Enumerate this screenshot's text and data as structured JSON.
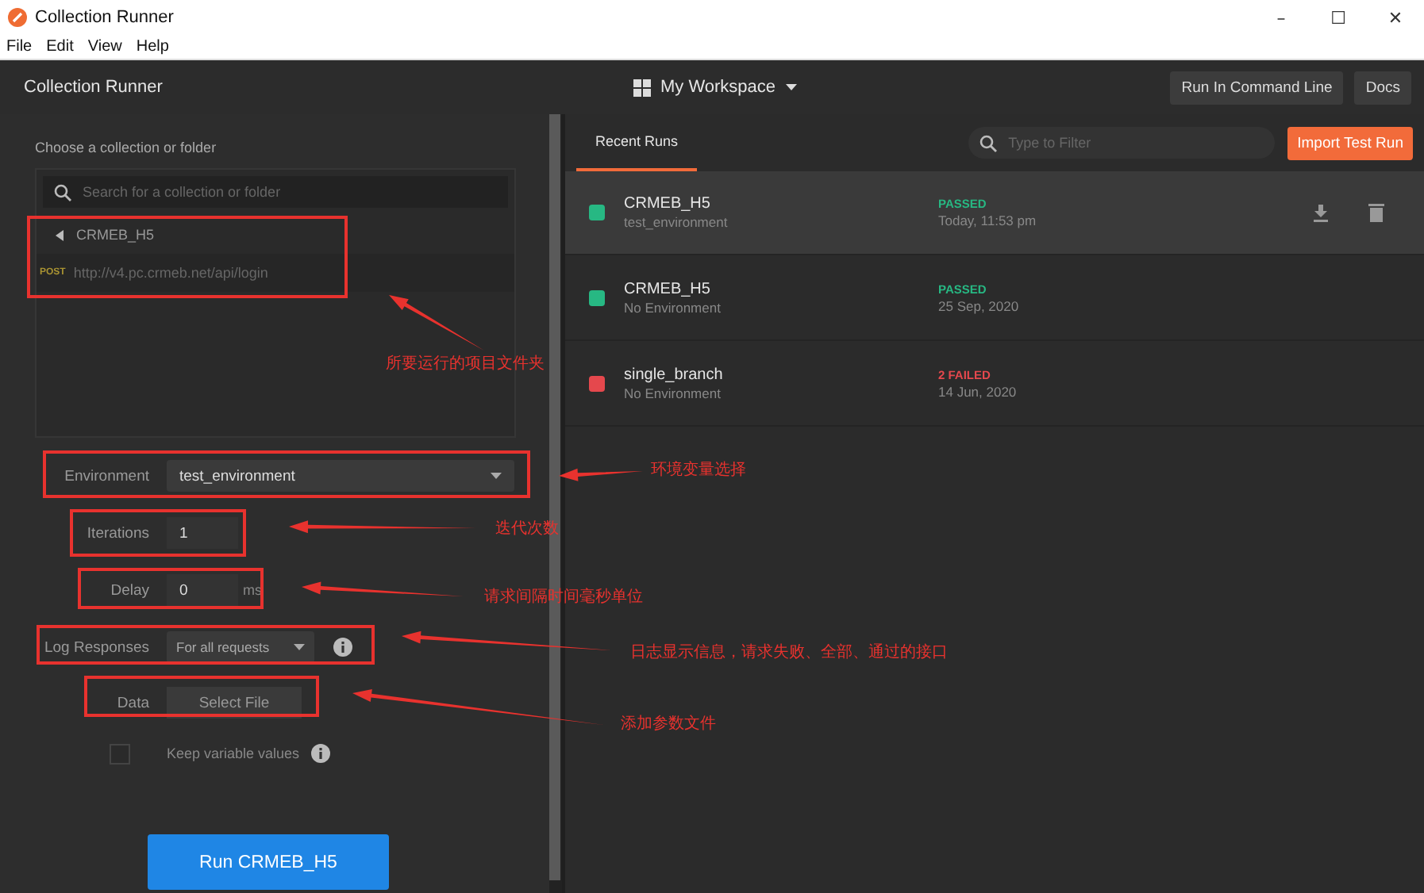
{
  "window": {
    "title": "Collection Runner",
    "controls": [
      "–",
      "☐",
      "✕"
    ]
  },
  "menu": [
    "File",
    "Edit",
    "View",
    "Help"
  ],
  "header": {
    "title": "Collection Runner",
    "workspace": "My Workspace",
    "buttons": [
      "Run In Command Line",
      "Docs"
    ]
  },
  "runner": {
    "choose_label": "Choose a collection or folder",
    "search": {
      "placeholder": "Search for a collection or folder"
    },
    "tree": {
      "name": "CRMEB_H5",
      "expanded": false,
      "requests": [
        {
          "method": "POST",
          "url": "http://v4.pc.crmeb.net/api/login"
        }
      ]
    },
    "environment": {
      "label": "Environment",
      "value": "test_environment"
    },
    "iterations": {
      "label": "Iterations",
      "value": "1"
    },
    "delay": {
      "label": "Delay",
      "value": "0",
      "unit": "ms"
    },
    "log_responses": {
      "label": "Log Responses",
      "value": "For all requests"
    },
    "data": {
      "label": "Data",
      "button": "Select File"
    },
    "keep_values": {
      "label": "Keep variable values",
      "checked": false
    },
    "run_button": "Run CRMEB_H5"
  },
  "recent": {
    "tabs": [
      {
        "label": "Recent Runs",
        "selected": true
      }
    ],
    "filter": {
      "placeholder": "Type to Filter"
    },
    "import_button": "Import Test Run",
    "runs": [
      {
        "name": "CRMEB_H5",
        "environment": "test_environment",
        "status": "PASSED",
        "kind": "passed",
        "color": "#27b883",
        "date": "Today, 11:53 pm",
        "selected": true
      },
      {
        "name": "CRMEB_H5",
        "environment": "No Environment",
        "status": "PASSED",
        "kind": "passed",
        "color": "#27b883",
        "date": "25 Sep, 2020",
        "selected": false
      },
      {
        "name": "single_branch",
        "environment": "No Environment",
        "status": "2 FAILED",
        "kind": "failed",
        "color": "#e5484d",
        "date": "14 Jun, 2020",
        "selected": false
      }
    ]
  },
  "annotations": [
    {
      "text": "所要运行的项目文件夹"
    },
    {
      "text": "环境变量选择"
    },
    {
      "text": "迭代次数"
    },
    {
      "text": "请求间隔时间毫秒单位"
    },
    {
      "text": "日志显示信息，请求失败、全部、通过的接口"
    },
    {
      "text": "添加参数文件"
    }
  ]
}
